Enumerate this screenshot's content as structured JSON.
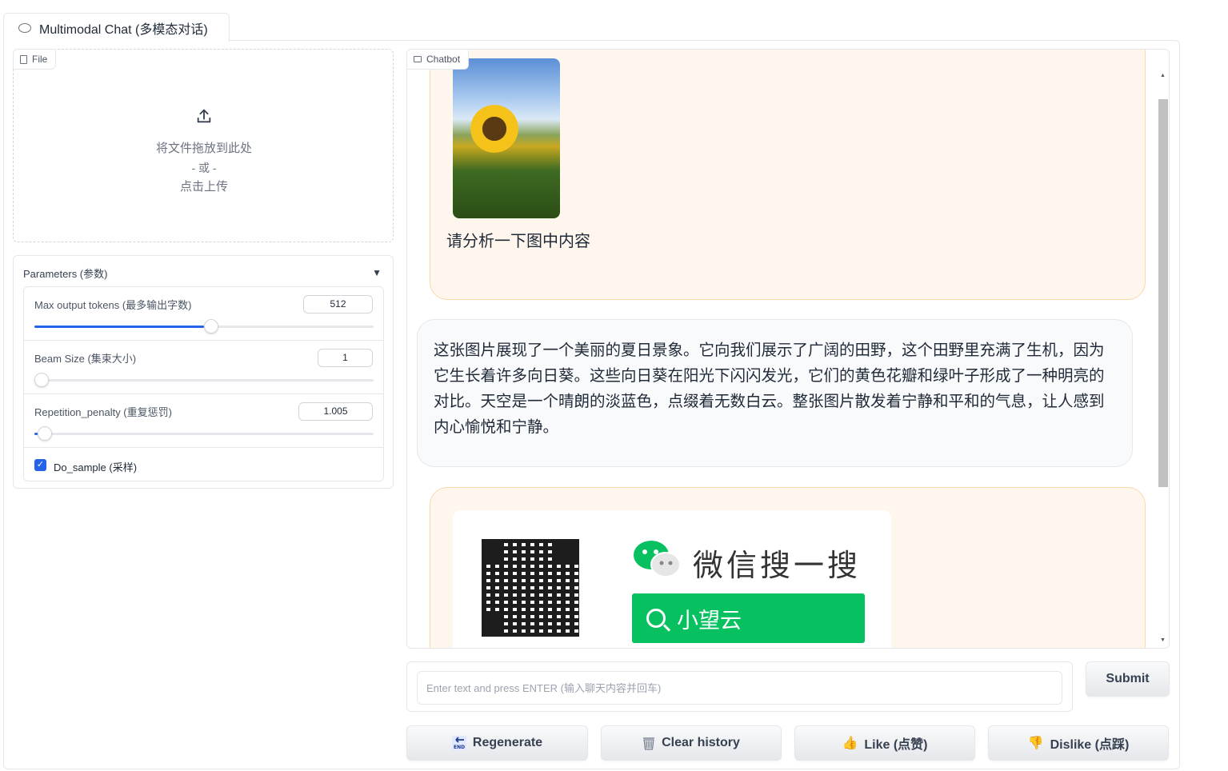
{
  "tab": {
    "label": "Multimodal Chat (多模态对话)"
  },
  "file": {
    "label": "File",
    "drop_text": "将文件拖放到此处",
    "or_text": "- 或 -",
    "click_text": "点击上传"
  },
  "parameters": {
    "title": "Parameters (参数)",
    "caret": "▼",
    "max_tokens": {
      "label": "Max output tokens (最多输出字数)",
      "value": "512",
      "fraction": 0.5
    },
    "beam_size": {
      "label": "Beam Size (集束大小)",
      "value": "1",
      "fraction": 0.0
    },
    "repetition_penalty": {
      "label": "Repetition_penalty (重复惩罚)",
      "value": "1.005",
      "fraction": 0.01
    },
    "do_sample": {
      "label": "Do_sample (采样)",
      "checked": true
    }
  },
  "chatbot": {
    "label": "Chatbot",
    "user_message": "请分析一下图中内容",
    "bot_message": "这张图片展现了一个美丽的夏日景象。它向我们展示了广阔的田野，这个田野里充满了生机，因为它生长着许多向日葵。这些向日葵在阳光下闪闪发光，它们的黄色花瓣和绿叶子形成了一种明亮的对比。天空是一个晴朗的淡蓝色，点缀着无数白云。整张图片散发着宁静和平和的气息，让人感到内心愉悦和宁静。",
    "qr_card": {
      "title": "微信搜一搜",
      "search_text": "小望云",
      "accent": "#07c160"
    }
  },
  "input": {
    "placeholder": "Enter text and press ENTER (输入聊天内容并回车)",
    "value": ""
  },
  "buttons": {
    "submit": "Submit",
    "regenerate": "Regenerate",
    "regenerate_icon": "end-arrow-icon",
    "clear": "Clear history",
    "clear_icon": "wastebasket-icon",
    "like": "Like (点赞)",
    "like_icon": "thumbs-up-icon",
    "dislike": "Dislike (点踩)",
    "dislike_icon": "thumbs-down-icon"
  },
  "colors": {
    "accent": "#2563eb",
    "user_bubble": "#fff7ed",
    "bot_bubble": "#f9fafb"
  }
}
